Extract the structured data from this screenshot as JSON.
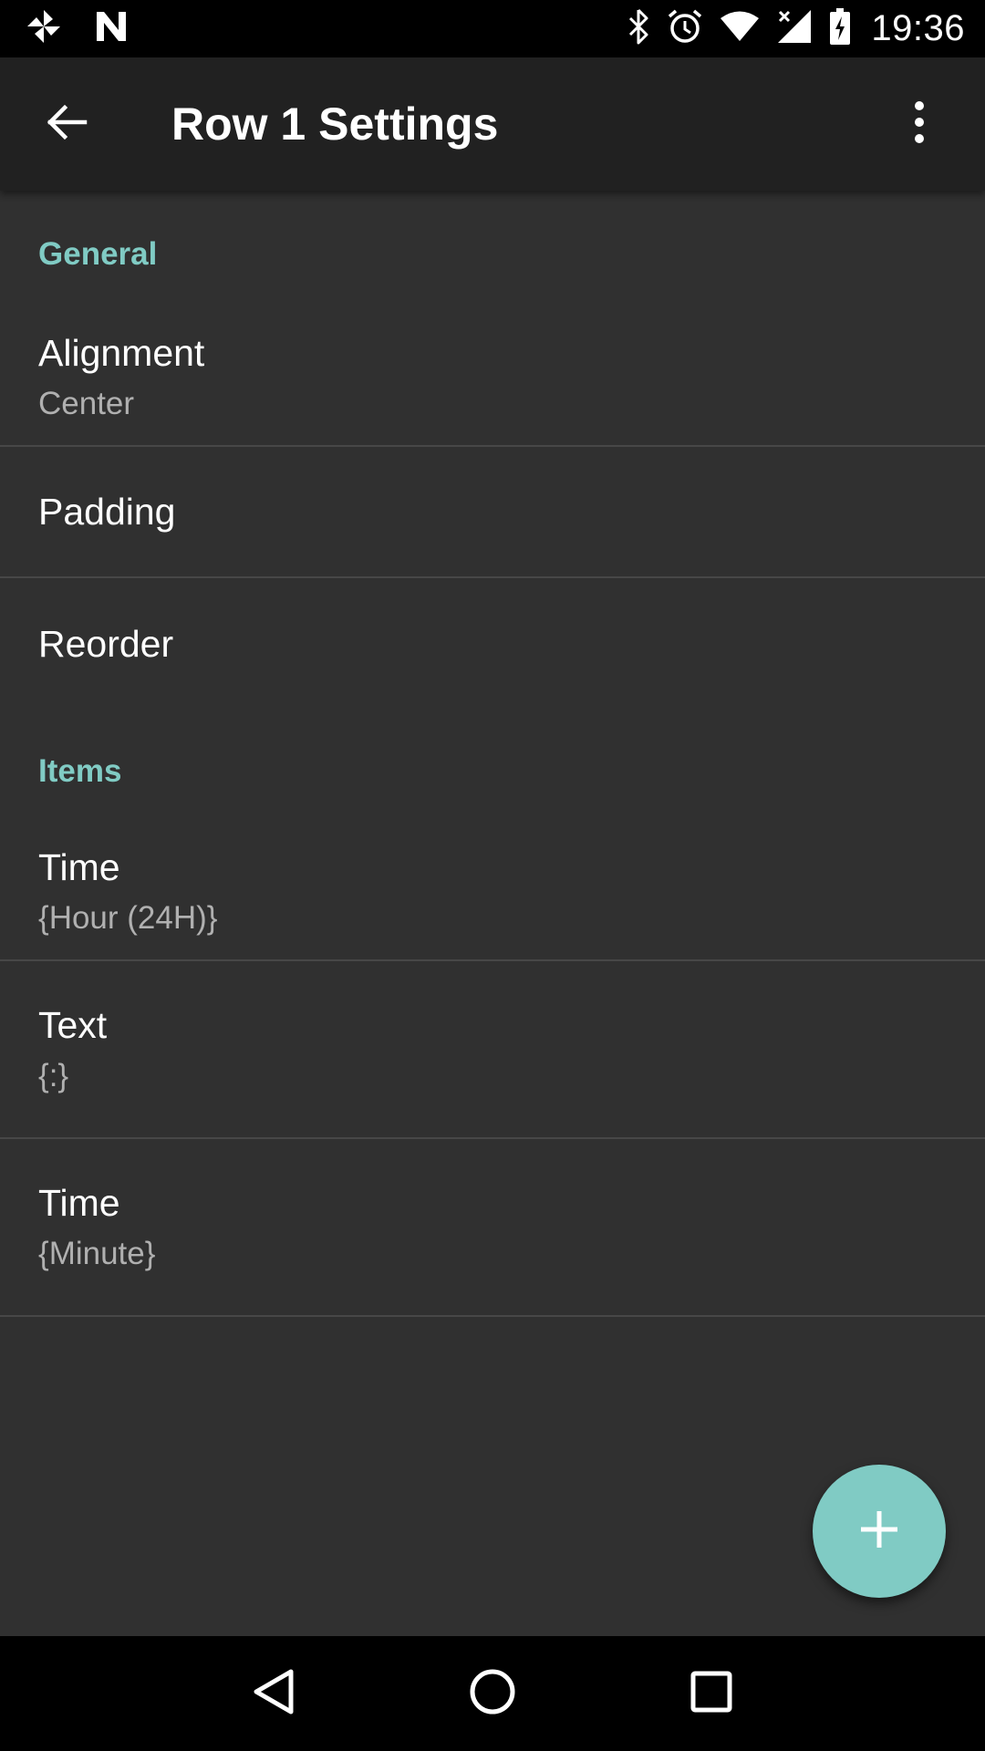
{
  "status_bar": {
    "time": "19:36",
    "left_icons": [
      "pinwheel-icon",
      "n-logo-icon"
    ],
    "right_icons": [
      "bluetooth-icon",
      "alarm-icon",
      "wifi-icon",
      "signal-icon",
      "battery-icon"
    ]
  },
  "app_bar": {
    "title": "Row 1 Settings",
    "back_icon": "arrow-back-icon",
    "more_icon": "more-vert-icon"
  },
  "sections": {
    "general": {
      "header": "General",
      "items": [
        {
          "title": "Alignment",
          "subtitle": "Center"
        },
        {
          "title": "Padding"
        },
        {
          "title": "Reorder"
        }
      ]
    },
    "items": {
      "header": "Items",
      "items": [
        {
          "title": "Time",
          "subtitle": "{Hour (24H)}"
        },
        {
          "title": "Text",
          "subtitle": "{:}"
        },
        {
          "title": "Time",
          "subtitle": "{Minute}"
        }
      ]
    }
  },
  "fab": {
    "icon": "plus-icon"
  },
  "colors": {
    "accent": "#80cbc4",
    "background": "#303030",
    "app_bar": "#212121",
    "divider": "#474747",
    "secondary_text": "#b0b0b0"
  },
  "nav_bar": {
    "buttons": [
      "back-triangle-icon",
      "home-circle-icon",
      "recents-square-icon"
    ]
  }
}
